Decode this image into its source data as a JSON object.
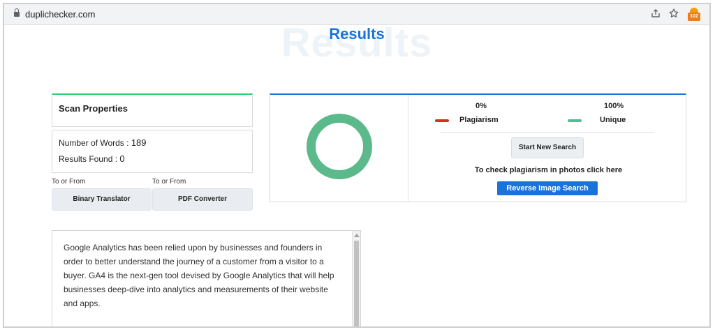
{
  "browser": {
    "url": "duplichecker.com",
    "share_icon": "share-icon",
    "bookmark_icon": "star-icon",
    "extension_badge": "102"
  },
  "page": {
    "watermark": "Results",
    "title": "Results"
  },
  "scan_properties": {
    "heading": "Scan Properties",
    "words_label": "Number of Words :",
    "words_value": "189",
    "results_label": "Results Found :",
    "results_value": "0"
  },
  "tools": [
    {
      "label": "To or From",
      "button": "Binary Translator"
    },
    {
      "label": "To or From",
      "button": "PDF Converter"
    }
  ],
  "results": {
    "plagiarism_percent": "0%",
    "unique_percent": "100%",
    "plagiarism_label": "Plagiarism",
    "unique_label": "Unique",
    "plagiarism_color": "#d93025",
    "unique_color": "#5bb98c",
    "start_button": "Start New Search",
    "check_text": "To check plagiarism in photos click here",
    "reverse_button": "Reverse Image Search"
  },
  "content": {
    "text": "Google Analytics has been relied upon by businesses and founders in order to better understand the journey of a customer from a visitor to a buyer. GA4 is the next-gen tool devised by Google Analytics that will help businesses deep-dive into analytics and measurements of their website and apps."
  }
}
